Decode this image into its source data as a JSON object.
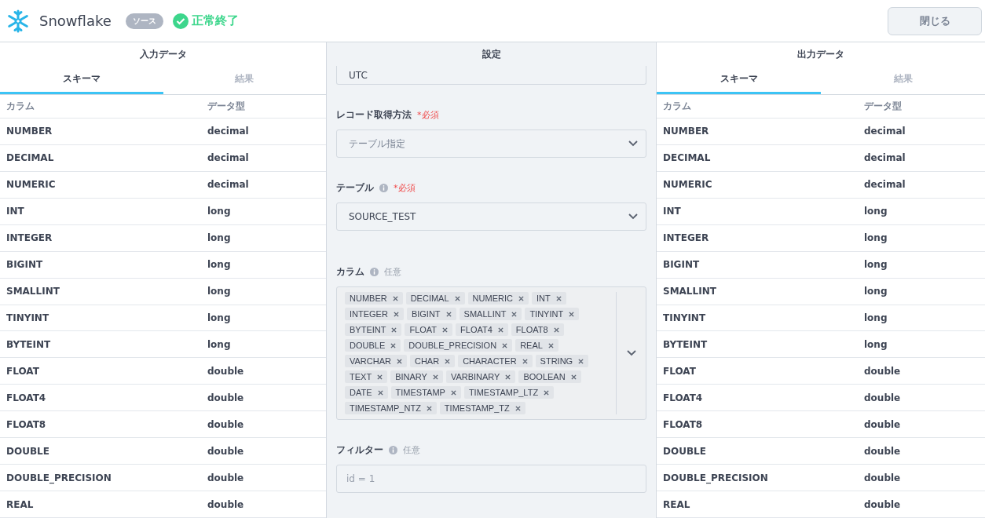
{
  "header": {
    "logo_text": "Snowflake",
    "badge": "ソース",
    "status": "正常終了",
    "close_button": "閉じる"
  },
  "input_panel": {
    "title": "入力データ",
    "tabs": [
      {
        "label": "スキーマ",
        "selected": true
      },
      {
        "label": "結果",
        "selected": false
      }
    ],
    "columns": [
      "カラム",
      "データ型"
    ],
    "rows": [
      {
        "name": "NUMBER",
        "type": "decimal"
      },
      {
        "name": "DECIMAL",
        "type": "decimal"
      },
      {
        "name": "NUMERIC",
        "type": "decimal"
      },
      {
        "name": "INT",
        "type": "long"
      },
      {
        "name": "INTEGER",
        "type": "long"
      },
      {
        "name": "BIGINT",
        "type": "long"
      },
      {
        "name": "SMALLINT",
        "type": "long"
      },
      {
        "name": "TINYINT",
        "type": "long"
      },
      {
        "name": "BYTEINT",
        "type": "long"
      },
      {
        "name": "FLOAT",
        "type": "double"
      },
      {
        "name": "FLOAT4",
        "type": "double"
      },
      {
        "name": "FLOAT8",
        "type": "double"
      },
      {
        "name": "DOUBLE",
        "type": "double"
      },
      {
        "name": "DOUBLE_PRECISION",
        "type": "double"
      },
      {
        "name": "REAL",
        "type": "double"
      }
    ]
  },
  "settings": {
    "title": "設定",
    "top_value": "UTC",
    "fields": [
      {
        "kind": "select",
        "label": "レコード取得方法",
        "info": false,
        "requirement": "*必須",
        "required": true,
        "value": "テーブル指定"
      },
      {
        "kind": "select",
        "label": "テーブル",
        "info": true,
        "requirement": "*必須",
        "required": true,
        "value": "SOURCE_TEST"
      },
      {
        "kind": "tags",
        "label": "カラム",
        "info": true,
        "requirement": "任意",
        "required": false,
        "tags": [
          "NUMBER",
          "DECIMAL",
          "NUMERIC",
          "INT",
          "INTEGER",
          "BIGINT",
          "SMALLINT",
          "TINYINT",
          "BYTEINT",
          "FLOAT",
          "FLOAT4",
          "FLOAT8",
          "DOUBLE",
          "DOUBLE_PRECISION",
          "REAL",
          "VARCHAR",
          "CHAR",
          "CHARACTER",
          "STRING",
          "TEXT",
          "BINARY",
          "VARBINARY",
          "BOOLEAN",
          "DATE",
          "TIMESTAMP",
          "TIMESTAMP_LTZ",
          "TIMESTAMP_NTZ",
          "TIMESTAMP_TZ"
        ]
      },
      {
        "kind": "input",
        "label": "フィルター",
        "info": true,
        "requirement": "任意",
        "required": false,
        "placeholder": "id = 1"
      }
    ]
  },
  "output_panel": {
    "title": "出力データ",
    "tabs": [
      {
        "label": "スキーマ",
        "selected": true
      },
      {
        "label": "結果",
        "selected": false
      }
    ],
    "columns": [
      "カラム",
      "データ型"
    ],
    "rows": [
      {
        "name": "NUMBER",
        "type": "decimal"
      },
      {
        "name": "DECIMAL",
        "type": "decimal"
      },
      {
        "name": "NUMERIC",
        "type": "decimal"
      },
      {
        "name": "INT",
        "type": "long"
      },
      {
        "name": "INTEGER",
        "type": "long"
      },
      {
        "name": "BIGINT",
        "type": "long"
      },
      {
        "name": "SMALLINT",
        "type": "long"
      },
      {
        "name": "TINYINT",
        "type": "long"
      },
      {
        "name": "BYTEINT",
        "type": "long"
      },
      {
        "name": "FLOAT",
        "type": "double"
      },
      {
        "name": "FLOAT4",
        "type": "double"
      },
      {
        "name": "FLOAT8",
        "type": "double"
      },
      {
        "name": "DOUBLE",
        "type": "double"
      },
      {
        "name": "DOUBLE_PRECISION",
        "type": "double"
      },
      {
        "name": "REAL",
        "type": "double"
      }
    ]
  }
}
